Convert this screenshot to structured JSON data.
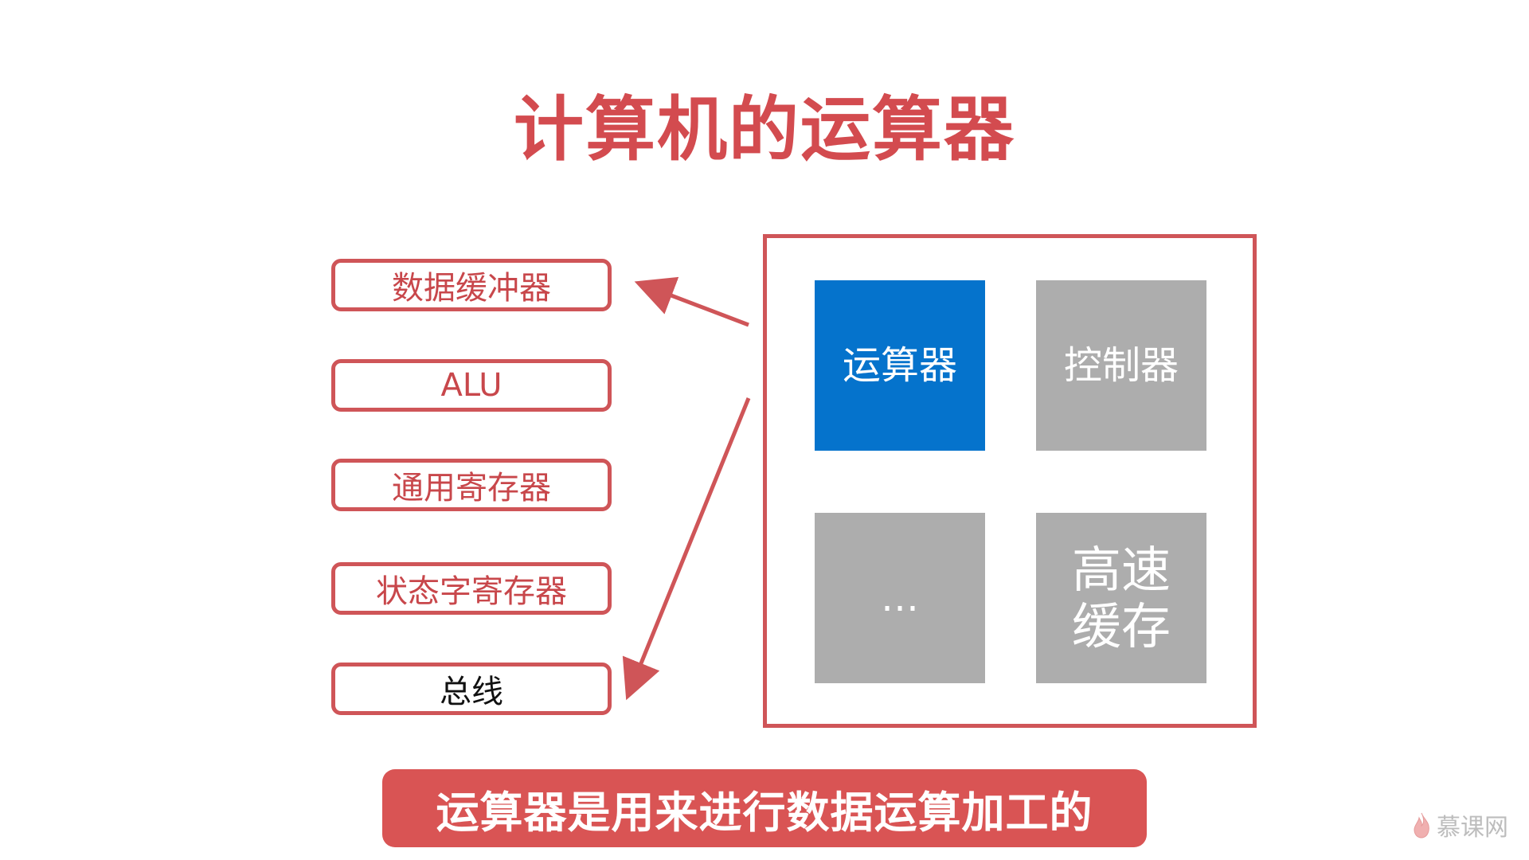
{
  "title": "计算机的运算器",
  "left_items": [
    "数据缓冲器",
    "ALU",
    "通用寄存器",
    "状态字寄存器",
    "总线"
  ],
  "tiles": {
    "alu_unit": "运算器",
    "control_unit": "控制器",
    "ellipsis": "…",
    "cache_line1": "高速",
    "cache_line2": "缓存"
  },
  "banner": "运算器是用来进行数据运算加工的",
  "watermark": "慕课网",
  "colors": {
    "accent_red": "#d34b4f",
    "frame_red": "#cf5558",
    "tile_blue": "#0573cc",
    "tile_gray": "#adadad",
    "banner_red": "#d95454"
  }
}
